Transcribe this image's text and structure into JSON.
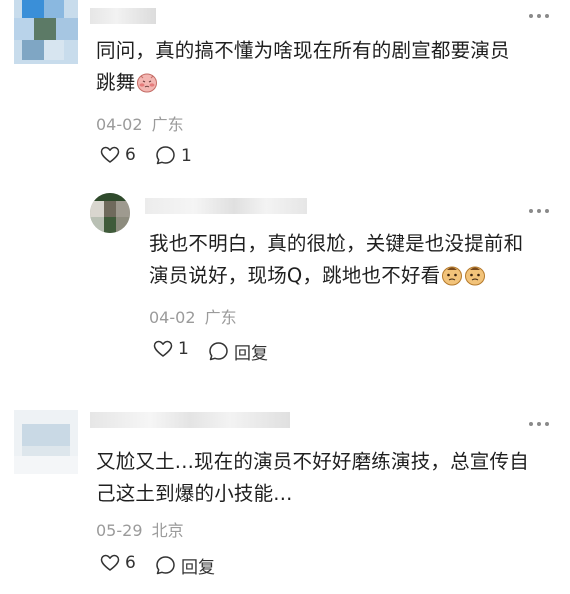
{
  "comments": [
    {
      "text_line1": "同问，真的搞不懂为啥现在所有的剧宣都要演员",
      "text_line2": "跳舞",
      "date": "04-02",
      "location": "广东",
      "likes": "6",
      "replies": "1",
      "emoji": "shy-face-emoji"
    },
    {
      "text_line1": "我也不明白，真的很尬，关键是也没提前和",
      "text_line2": "演员说好，现场Q，跳地也不好看",
      "date": "04-02",
      "location": "广东",
      "likes": "1",
      "reply_label": "回复",
      "emoji": "awkward-face-emoji"
    },
    {
      "text_line1": "又尬又土...现在的演员不好好磨练演技，总宣传自",
      "text_line2": "己这土到爆的小技能...",
      "date": "05-29",
      "location": "北京",
      "likes": "6",
      "reply_label": "回复"
    }
  ],
  "colors": {
    "meta_text": "#9b9b9b",
    "body_text": "#1f1f1f",
    "icon_stroke": "#333333"
  }
}
